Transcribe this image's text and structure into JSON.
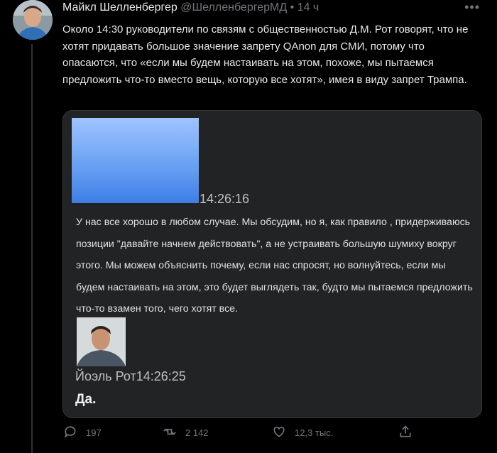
{
  "tweet": {
    "author_name": "Майкл Шелленбергер",
    "author_handle": "@ШелленбергерМД",
    "separator": "•",
    "time_ago": "14 ч",
    "text": "Около 14:30 руководители по связям с общественностью Д.М. Рот говорят, что не хотят придавать большое значение запрету QAnon для СМИ, потому что опасаются, что «если мы будем настаивать на этом, похоже, мы пытаемся предложить что-то вместо вещь, которую все хотят», имея в виду запрет Трампа."
  },
  "embedded": {
    "first_timestamp": "14:26:16",
    "message": "У нас все хорошо в любом случае. Мы обсудим, но я, как правило , придерживаюсь позиции \"давайте начнем действовать\", а не устраивать большую шумиху вокруг этого. Мы можем объяснить почему, если нас спросят, но волнуйтесь, если мы будем настаивать на этом, это будет выглядеть так, будто мы пытаемся предложить что-то взамен того, чего хотят все.",
    "sender_name": "Йоэль Рот",
    "sender_timestamp": "14:26:25",
    "reply_text": "Да."
  },
  "actions": {
    "replies": "197",
    "retweets": "2 142",
    "likes": "12,3 тыс."
  },
  "colors": {
    "background": "#000000",
    "muted": "#71767b",
    "card": "#222325"
  }
}
